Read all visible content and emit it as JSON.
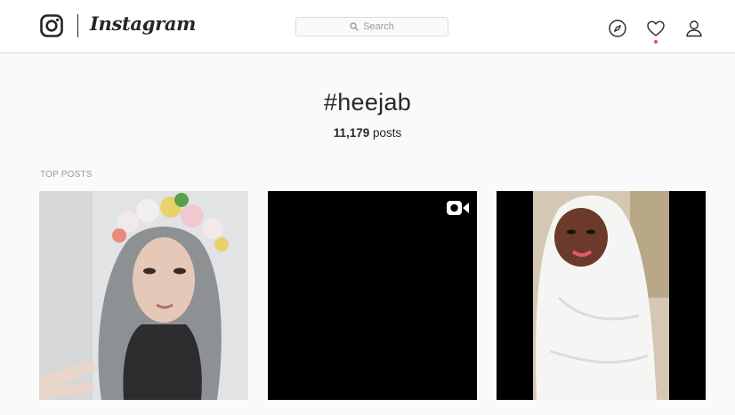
{
  "header": {
    "wordmark": "Instagram",
    "search_placeholder": "Search",
    "icons": [
      "instagram-logo-icon",
      "search-icon",
      "compass-icon",
      "heart-icon",
      "user-icon"
    ],
    "notification_dot_color": "#ed4956"
  },
  "hashtag": {
    "title": "#heejab",
    "post_count": "11,179",
    "post_suffix": "posts"
  },
  "section": {
    "top_posts_label": "TOP POSTS"
  },
  "posts": [
    {
      "kind": "photo",
      "description_icon": "photo-tile"
    },
    {
      "kind": "video",
      "description_icon": "video-camera-icon"
    },
    {
      "kind": "photo",
      "description_icon": "photo-tile"
    }
  ],
  "colors": {
    "page_background": "#fafafa",
    "header_background": "#ffffff",
    "border": "#dbdbdb",
    "text_primary": "#262626",
    "text_muted": "#999999"
  }
}
